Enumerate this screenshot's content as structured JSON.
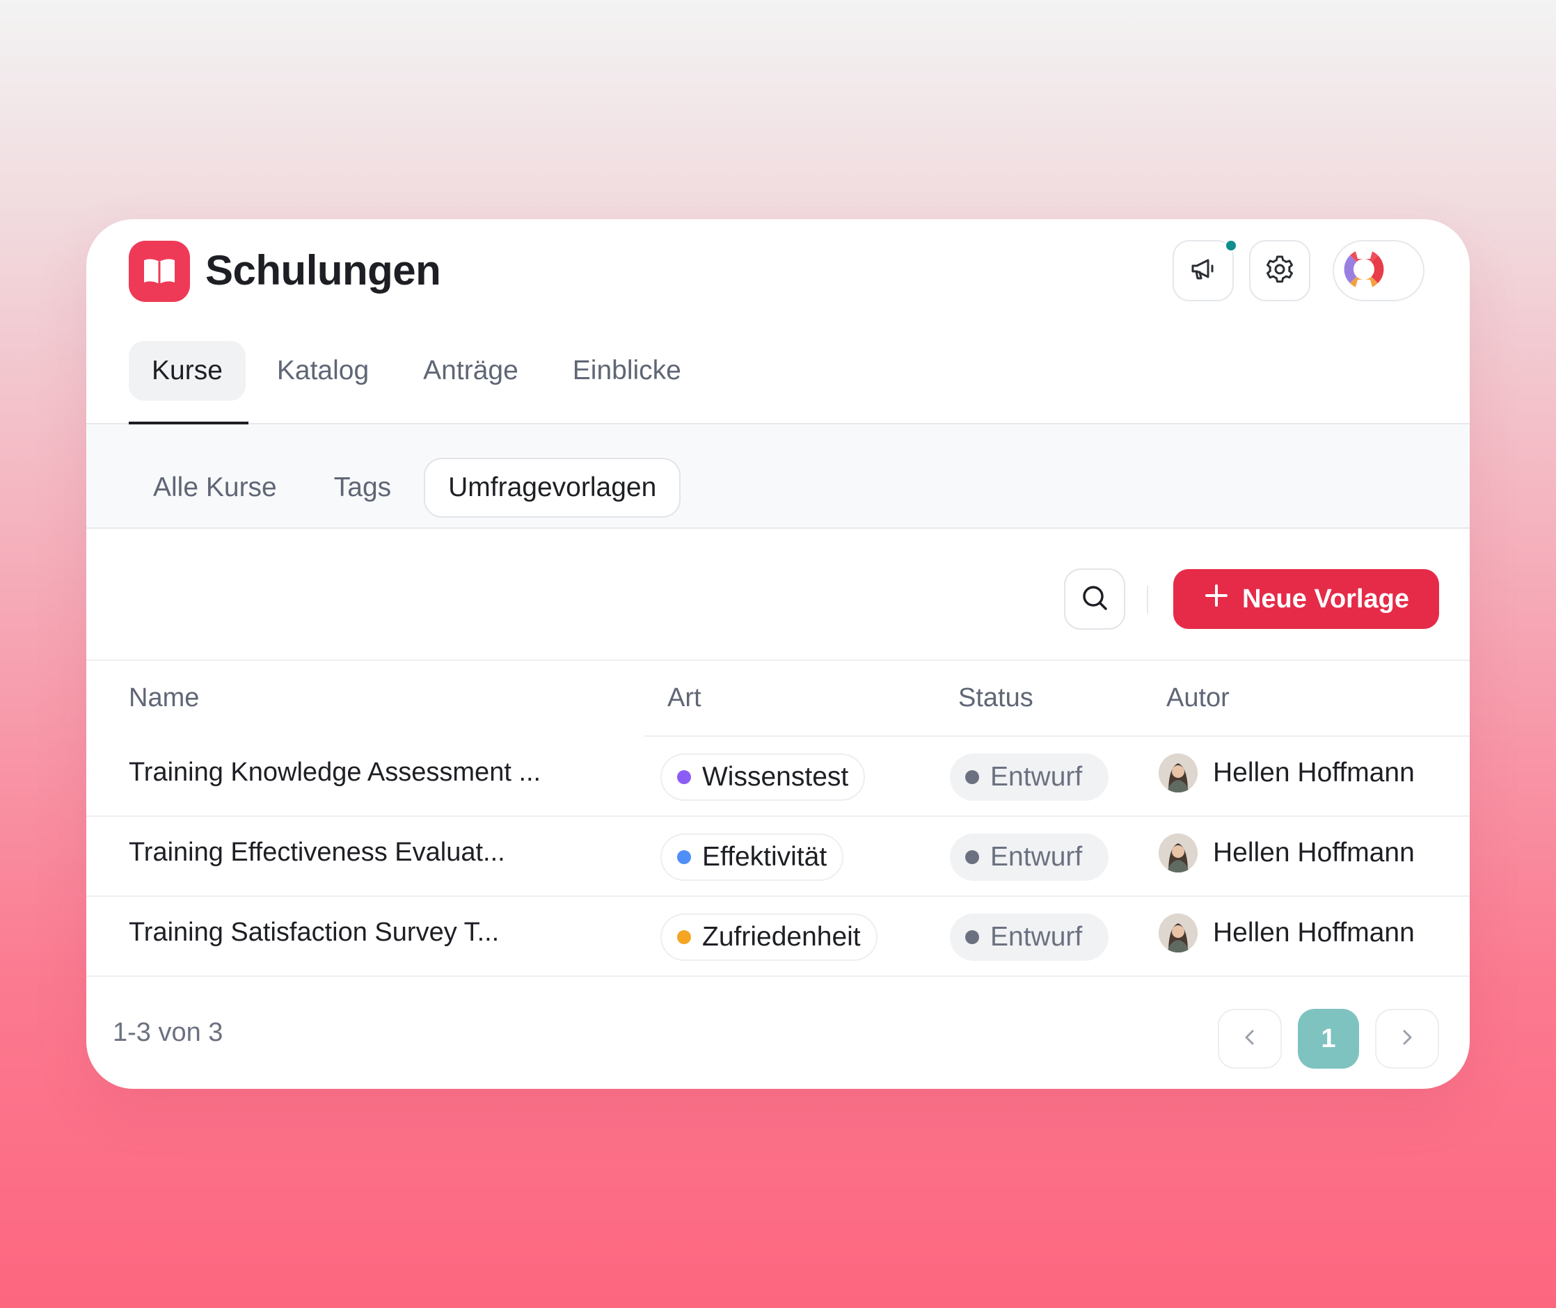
{
  "app": {
    "title": "Schulungen",
    "accent_color": "#ee3a57",
    "logo_icon": "book-open-icon"
  },
  "header_actions": {
    "announcements_icon": "megaphone-icon",
    "settings_icon": "gear-icon",
    "profile_icon": "lifebuoy-avatar-icon",
    "notification_color": "#0f8f8c"
  },
  "tabs": [
    {
      "label": "Kurse",
      "active": true
    },
    {
      "label": "Katalog",
      "active": false
    },
    {
      "label": "Anträge",
      "active": false
    },
    {
      "label": "Einblicke",
      "active": false
    }
  ],
  "subtabs": [
    {
      "label": "Alle Kurse",
      "active": false
    },
    {
      "label": "Tags",
      "active": false
    },
    {
      "label": "Umfragevorlagen",
      "active": true
    }
  ],
  "toolbar": {
    "search_icon": "search-icon",
    "new_button_label": "Neue Vorlage",
    "new_button_color": "#e52b48"
  },
  "table": {
    "columns": [
      "Name",
      "Art",
      "Status",
      "Autor"
    ],
    "rows": [
      {
        "name": "Training Knowledge Assessment ...",
        "type": "Wissenstest",
        "type_color": "#8b5cf6",
        "status": "Entwurf",
        "author": "Hellen Hoffmann"
      },
      {
        "name": "Training Effectiveness Evaluat...",
        "type": "Effektivität",
        "type_color": "#4f8ff7",
        "status": "Entwurf",
        "author": "Hellen Hoffmann"
      },
      {
        "name": "Training Satisfaction Survey T...",
        "type": "Zufriedenheit",
        "type_color": "#f5a524",
        "status": "Entwurf",
        "author": "Hellen Hoffmann"
      }
    ]
  },
  "pagination": {
    "summary": "1-3 von 3",
    "current_page": "1",
    "current_color": "#7fc3c1"
  }
}
